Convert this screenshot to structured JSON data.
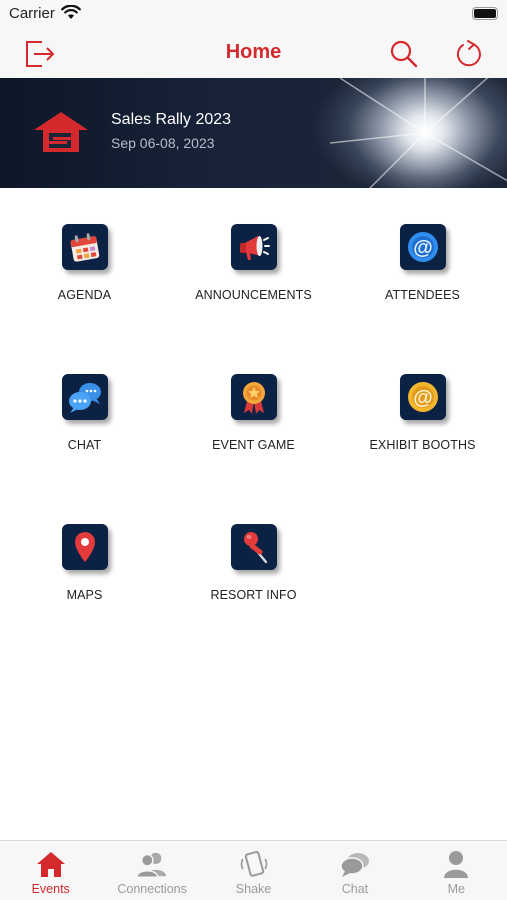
{
  "status_bar": {
    "carrier": "Carrier"
  },
  "header": {
    "title": "Home"
  },
  "banner": {
    "title": "Sales Rally 2023",
    "date": "Sep 06-08, 2023"
  },
  "tiles": [
    {
      "label": "AGENDA",
      "icon": "calendar-icon"
    },
    {
      "label": "ANNOUNCEMENTS",
      "icon": "megaphone-icon"
    },
    {
      "label": "ATTENDEES",
      "icon": "at-sign-icon"
    },
    {
      "label": "CHAT",
      "icon": "chat-bubbles-icon"
    },
    {
      "label": "EVENT GAME",
      "icon": "award-ribbon-icon"
    },
    {
      "label": "EXHIBIT BOOTHS",
      "icon": "at-sign-gold-icon"
    },
    {
      "label": "MAPS",
      "icon": "map-pin-icon"
    },
    {
      "label": "RESORT INFO",
      "icon": "pushpin-icon"
    }
  ],
  "tab_bar": {
    "tabs": [
      {
        "label": "Events",
        "icon": "home-icon",
        "active": true
      },
      {
        "label": "Connections",
        "icon": "people-icon",
        "active": false
      },
      {
        "label": "Shake",
        "icon": "shake-phone-icon",
        "active": false
      },
      {
        "label": "Chat",
        "icon": "chat-icon",
        "active": false
      },
      {
        "label": "Me",
        "icon": "person-icon",
        "active": false
      }
    ]
  },
  "colors": {
    "accent": "#d42a2e",
    "tile_bg": "#0c2245",
    "inactive": "#9a9a9a"
  }
}
